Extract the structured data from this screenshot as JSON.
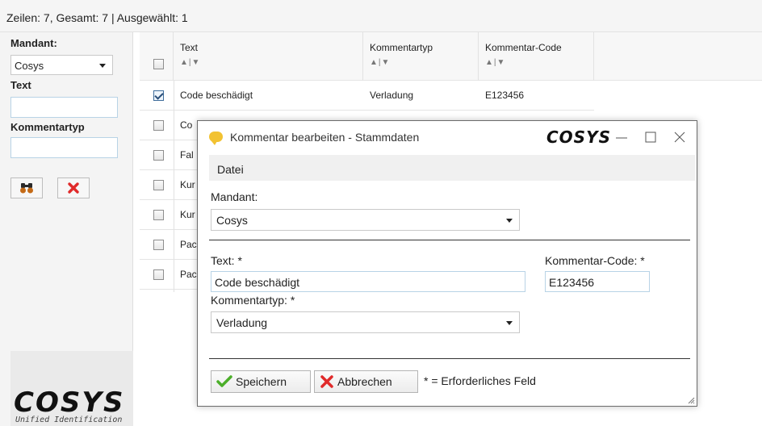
{
  "status": {
    "text": "Zeilen: 7, Gesamt: 7  |  Ausgewählt: 1"
  },
  "filter": {
    "mandant_label": "Mandant:",
    "mandant_value": "Cosys",
    "text_label": "Text",
    "text_value": "",
    "kommentartyp_label": "Kommentartyp",
    "kommentartyp_value": "",
    "search_icon": "binoculars-icon",
    "clear_icon": "red-x-icon",
    "logo_text": "COSYS",
    "logo_subtext": "Unified Identification"
  },
  "grid": {
    "columns": [
      {
        "label": "Text",
        "sort": "▲|▼"
      },
      {
        "label": "Kommentartyp",
        "sort": "▲|▼"
      },
      {
        "label": "Kommentar-Code",
        "sort": "▲|▼"
      }
    ],
    "rows": [
      {
        "checked": true,
        "text": "Code beschädigt",
        "typ": "Verladung",
        "code": "E123456"
      },
      {
        "checked": false,
        "text": "Co",
        "typ": "",
        "code": ""
      },
      {
        "checked": false,
        "text": "Fal",
        "typ": "",
        "code": ""
      },
      {
        "checked": false,
        "text": "Kur",
        "typ": "",
        "code": ""
      },
      {
        "checked": false,
        "text": "Kur",
        "typ": "",
        "code": ""
      },
      {
        "checked": false,
        "text": "Pac",
        "typ": "",
        "code": ""
      },
      {
        "checked": false,
        "text": "Pac",
        "typ": "",
        "code": ""
      }
    ]
  },
  "dialog": {
    "title": "Kommentar bearbeiten - Stammdaten",
    "brand": "COSYS",
    "menu": "Datei",
    "mandant_label": "Mandant:",
    "mandant_value": "Cosys",
    "text_label": "Text: *",
    "text_value": "Code beschädigt",
    "code_label": "Kommentar-Code: *",
    "code_value": "E123456",
    "typ_label": "Kommentartyp: *",
    "typ_value": "Verladung",
    "save_label": "Speichern",
    "cancel_label": "Abbrechen",
    "required_note": "* = Erforderliches Feld"
  },
  "colors": {
    "accent_border": "#b8d3e6",
    "check_green": "#4caf2a",
    "cancel_red": "#e02a2a",
    "chat_icon": "#f2c232"
  }
}
